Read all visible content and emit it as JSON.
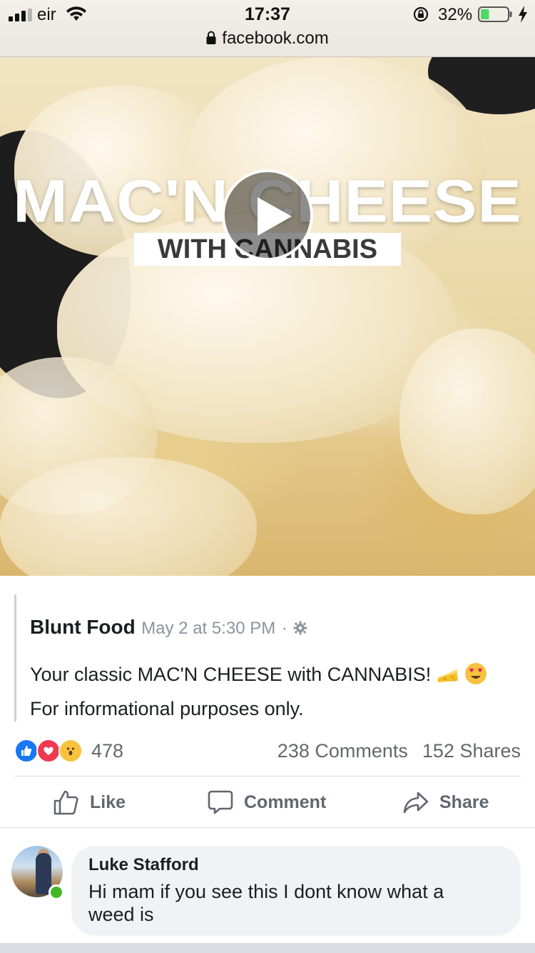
{
  "status_bar": {
    "carrier": "eir",
    "time": "17:37",
    "battery_percent": "32%",
    "battery_level": 0.32,
    "url": "facebook.com"
  },
  "video": {
    "title": "MAC'N CHEESE",
    "subtitle": "WITH CANNABIS"
  },
  "post": {
    "author": "Blunt Food",
    "timestamp": "May 2 at 5:30 PM",
    "separator": "·",
    "text_line1": "Your classic MAC'N CHEESE with CANNABIS!",
    "text_line2": "For informational purposes only.",
    "reaction_count": "478",
    "comments": "238 Comments",
    "shares": "152 Shares"
  },
  "actions": {
    "like": "Like",
    "comment": "Comment",
    "share": "Share"
  },
  "comment": {
    "author": "Luke Stafford",
    "text": "Hi mam if you see this I dont know what a weed is"
  },
  "colors": {
    "facebook_blue": "#1877f2",
    "love_red": "#f0394f",
    "wow_yellow": "#f7c23e",
    "online_green": "#42b72a",
    "muted_text": "#65676b"
  }
}
